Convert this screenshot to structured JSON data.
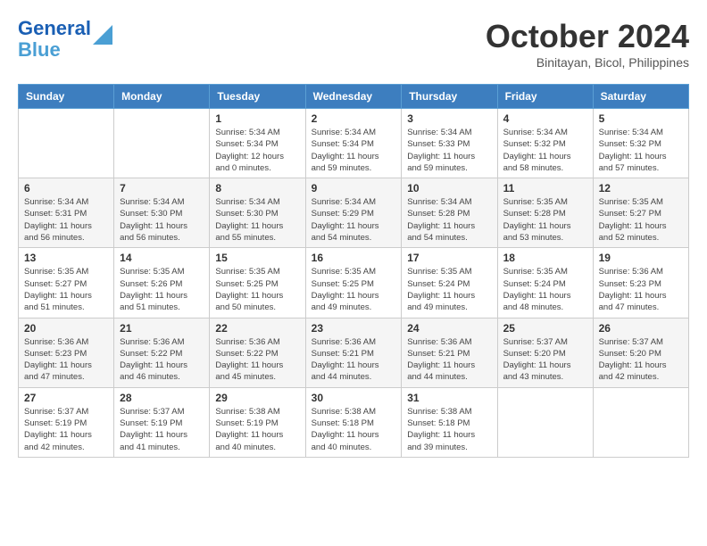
{
  "logo": {
    "line1": "General",
    "line2": "Blue"
  },
  "title": "October 2024",
  "subtitle": "Binitayan, Bicol, Philippines",
  "headers": [
    "Sunday",
    "Monday",
    "Tuesday",
    "Wednesday",
    "Thursday",
    "Friday",
    "Saturday"
  ],
  "weeks": [
    [
      {
        "day": "",
        "content": ""
      },
      {
        "day": "",
        "content": ""
      },
      {
        "day": "1",
        "content": "Sunrise: 5:34 AM\nSunset: 5:34 PM\nDaylight: 12 hours\nand 0 minutes."
      },
      {
        "day": "2",
        "content": "Sunrise: 5:34 AM\nSunset: 5:34 PM\nDaylight: 11 hours\nand 59 minutes."
      },
      {
        "day": "3",
        "content": "Sunrise: 5:34 AM\nSunset: 5:33 PM\nDaylight: 11 hours\nand 59 minutes."
      },
      {
        "day": "4",
        "content": "Sunrise: 5:34 AM\nSunset: 5:32 PM\nDaylight: 11 hours\nand 58 minutes."
      },
      {
        "day": "5",
        "content": "Sunrise: 5:34 AM\nSunset: 5:32 PM\nDaylight: 11 hours\nand 57 minutes."
      }
    ],
    [
      {
        "day": "6",
        "content": "Sunrise: 5:34 AM\nSunset: 5:31 PM\nDaylight: 11 hours\nand 56 minutes."
      },
      {
        "day": "7",
        "content": "Sunrise: 5:34 AM\nSunset: 5:30 PM\nDaylight: 11 hours\nand 56 minutes."
      },
      {
        "day": "8",
        "content": "Sunrise: 5:34 AM\nSunset: 5:30 PM\nDaylight: 11 hours\nand 55 minutes."
      },
      {
        "day": "9",
        "content": "Sunrise: 5:34 AM\nSunset: 5:29 PM\nDaylight: 11 hours\nand 54 minutes."
      },
      {
        "day": "10",
        "content": "Sunrise: 5:34 AM\nSunset: 5:28 PM\nDaylight: 11 hours\nand 54 minutes."
      },
      {
        "day": "11",
        "content": "Sunrise: 5:35 AM\nSunset: 5:28 PM\nDaylight: 11 hours\nand 53 minutes."
      },
      {
        "day": "12",
        "content": "Sunrise: 5:35 AM\nSunset: 5:27 PM\nDaylight: 11 hours\nand 52 minutes."
      }
    ],
    [
      {
        "day": "13",
        "content": "Sunrise: 5:35 AM\nSunset: 5:27 PM\nDaylight: 11 hours\nand 51 minutes."
      },
      {
        "day": "14",
        "content": "Sunrise: 5:35 AM\nSunset: 5:26 PM\nDaylight: 11 hours\nand 51 minutes."
      },
      {
        "day": "15",
        "content": "Sunrise: 5:35 AM\nSunset: 5:25 PM\nDaylight: 11 hours\nand 50 minutes."
      },
      {
        "day": "16",
        "content": "Sunrise: 5:35 AM\nSunset: 5:25 PM\nDaylight: 11 hours\nand 49 minutes."
      },
      {
        "day": "17",
        "content": "Sunrise: 5:35 AM\nSunset: 5:24 PM\nDaylight: 11 hours\nand 49 minutes."
      },
      {
        "day": "18",
        "content": "Sunrise: 5:35 AM\nSunset: 5:24 PM\nDaylight: 11 hours\nand 48 minutes."
      },
      {
        "day": "19",
        "content": "Sunrise: 5:36 AM\nSunset: 5:23 PM\nDaylight: 11 hours\nand 47 minutes."
      }
    ],
    [
      {
        "day": "20",
        "content": "Sunrise: 5:36 AM\nSunset: 5:23 PM\nDaylight: 11 hours\nand 47 minutes."
      },
      {
        "day": "21",
        "content": "Sunrise: 5:36 AM\nSunset: 5:22 PM\nDaylight: 11 hours\nand 46 minutes."
      },
      {
        "day": "22",
        "content": "Sunrise: 5:36 AM\nSunset: 5:22 PM\nDaylight: 11 hours\nand 45 minutes."
      },
      {
        "day": "23",
        "content": "Sunrise: 5:36 AM\nSunset: 5:21 PM\nDaylight: 11 hours\nand 44 minutes."
      },
      {
        "day": "24",
        "content": "Sunrise: 5:36 AM\nSunset: 5:21 PM\nDaylight: 11 hours\nand 44 minutes."
      },
      {
        "day": "25",
        "content": "Sunrise: 5:37 AM\nSunset: 5:20 PM\nDaylight: 11 hours\nand 43 minutes."
      },
      {
        "day": "26",
        "content": "Sunrise: 5:37 AM\nSunset: 5:20 PM\nDaylight: 11 hours\nand 42 minutes."
      }
    ],
    [
      {
        "day": "27",
        "content": "Sunrise: 5:37 AM\nSunset: 5:19 PM\nDaylight: 11 hours\nand 42 minutes."
      },
      {
        "day": "28",
        "content": "Sunrise: 5:37 AM\nSunset: 5:19 PM\nDaylight: 11 hours\nand 41 minutes."
      },
      {
        "day": "29",
        "content": "Sunrise: 5:38 AM\nSunset: 5:19 PM\nDaylight: 11 hours\nand 40 minutes."
      },
      {
        "day": "30",
        "content": "Sunrise: 5:38 AM\nSunset: 5:18 PM\nDaylight: 11 hours\nand 40 minutes."
      },
      {
        "day": "31",
        "content": "Sunrise: 5:38 AM\nSunset: 5:18 PM\nDaylight: 11 hours\nand 39 minutes."
      },
      {
        "day": "",
        "content": ""
      },
      {
        "day": "",
        "content": ""
      }
    ]
  ]
}
